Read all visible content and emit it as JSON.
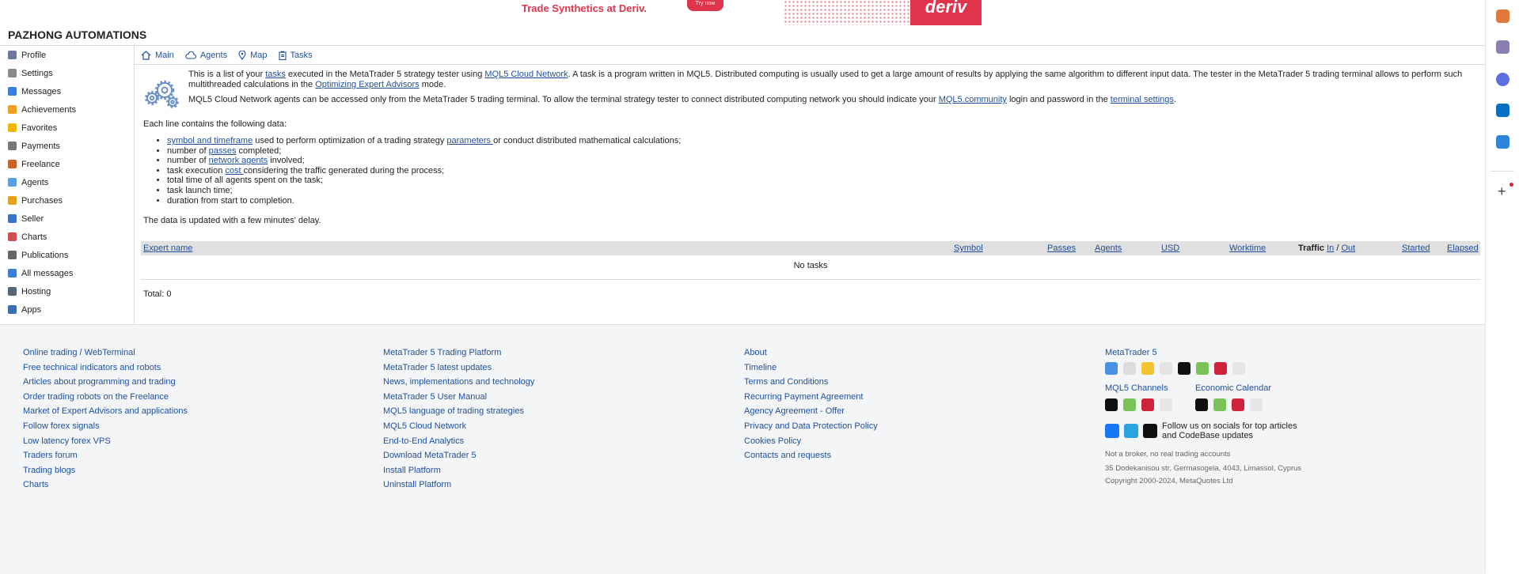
{
  "banner": {
    "promo": "Trade Synthetics at Deriv.",
    "try": "Try now",
    "brand": "deriv"
  },
  "site_title": "PAZHONG AUTOMATIONS",
  "sidebar": {
    "items": [
      {
        "label": "Profile",
        "color": "#6b7a99"
      },
      {
        "label": "Settings",
        "color": "#8a8a8a"
      },
      {
        "label": "Messages",
        "color": "#3b7dd8"
      },
      {
        "label": "Achievements",
        "color": "#f0a020"
      },
      {
        "label": "Favorites",
        "color": "#f2b600"
      },
      {
        "label": "Payments",
        "color": "#777777"
      },
      {
        "label": "Freelance",
        "color": "#c8642a"
      },
      {
        "label": "Agents",
        "color": "#5aa0e0"
      },
      {
        "label": "Purchases",
        "color": "#e8a020"
      },
      {
        "label": "Seller",
        "color": "#3a74c9"
      },
      {
        "label": "Charts",
        "color": "#d05050"
      },
      {
        "label": "Publications",
        "color": "#666666"
      },
      {
        "label": "All messages",
        "color": "#3b7dd8"
      },
      {
        "label": "Hosting",
        "color": "#556677"
      },
      {
        "label": "Apps",
        "color": "#3b6fb0"
      }
    ]
  },
  "tabs": [
    "Main",
    "Agents",
    "Map",
    "Tasks"
  ],
  "intro": {
    "p1_a": "This is a list of your ",
    "p1_link1": "tasks",
    "p1_b": " executed in the MetaTrader 5 strategy tester using ",
    "p1_link2": "MQL5 Cloud Network",
    "p1_c": ". A task is a program written in MQL5. Distributed computing is usually used to get a large amount of results by applying the same algorithm to different input data. The tester in the MetaTrader 5 trading terminal allows to perform such multithreaded calculations in the ",
    "p1_link3": "Optimizing Expert Advisors",
    "p1_d": " mode.",
    "p2_a": "MQL5 Cloud Network agents can be accessed only from the MetaTrader 5 trading terminal. To allow the terminal strategy tester to connect distributed computing network you should indicate your ",
    "p2_link1": "MQL5.community",
    "p2_b": " login and password in the ",
    "p2_link2": "terminal settings",
    "p2_c": "."
  },
  "lines_header": "Each line contains the following data:",
  "lines": {
    "l1_link": "symbol and timeframe",
    "l1_a": " used to perform optimization of a trading strategy ",
    "l1_link2": "parameters ",
    "l1_b": "or conduct distributed mathematical calculations;",
    "l2_a": "number of ",
    "l2_link": "passes",
    "l2_b": " completed;",
    "l3_a": "number of ",
    "l3_link": "network agents",
    "l3_b": " involved;",
    "l4_a": "task execution ",
    "l4_link": "cost ",
    "l4_b": "considering the traffic generated during the process;",
    "l5": "total time of all agents spent on the task;",
    "l6": "task launch time;",
    "l7": "duration from start to completion."
  },
  "delay_note": "The data is updated with a few minutes' delay.",
  "table": {
    "expert": "Expert name",
    "symbol": "Symbol",
    "passes": "Passes",
    "agents": "Agents",
    "usd": "USD",
    "worktime": "Worktime",
    "traffic": "Traffic",
    "in": "In",
    "slash": " / ",
    "out": "Out",
    "started": "Started",
    "elapsed": "Elapsed",
    "empty": "No tasks"
  },
  "total": "Total: 0",
  "footer": {
    "col1": [
      "Online trading / WebTerminal",
      "Free technical indicators and robots",
      "Articles about programming and trading",
      "Order trading robots on the Freelance",
      "Market of Expert Advisors and applications",
      "Follow forex signals",
      "Low latency forex VPS",
      "Traders forum",
      "Trading blogs",
      "Charts"
    ],
    "col2": [
      "MetaTrader 5 Trading Platform",
      "MetaTrader 5 latest updates",
      "News, implementations and technology",
      "MetaTrader 5 User Manual",
      "MQL5 language of trading strategies",
      "MQL5 Cloud Network",
      "End-to-End Analytics",
      "Download MetaTrader 5",
      "Install Platform",
      "Uninstall Platform"
    ],
    "col3": [
      "About",
      "Timeline",
      "Terms and Conditions",
      "Recurring Payment Agreement",
      "Agency Agreement - Offer",
      "Privacy and Data Protection Policy",
      "Cookies Policy",
      "Contacts and requests"
    ],
    "mt5": "MetaTrader 5",
    "channels": "MQL5 Channels",
    "calendar": "Economic Calendar",
    "social": "Follow us on socials for top articles and CodeBase updates",
    "not_broker": "Not a broker, no real trading accounts",
    "address": "35 Dodekanisou str, Germasogeia, 4043, Limassol, Cyprus",
    "copyright": "Copyright 2000-2024, MetaQuotes Ltd"
  }
}
